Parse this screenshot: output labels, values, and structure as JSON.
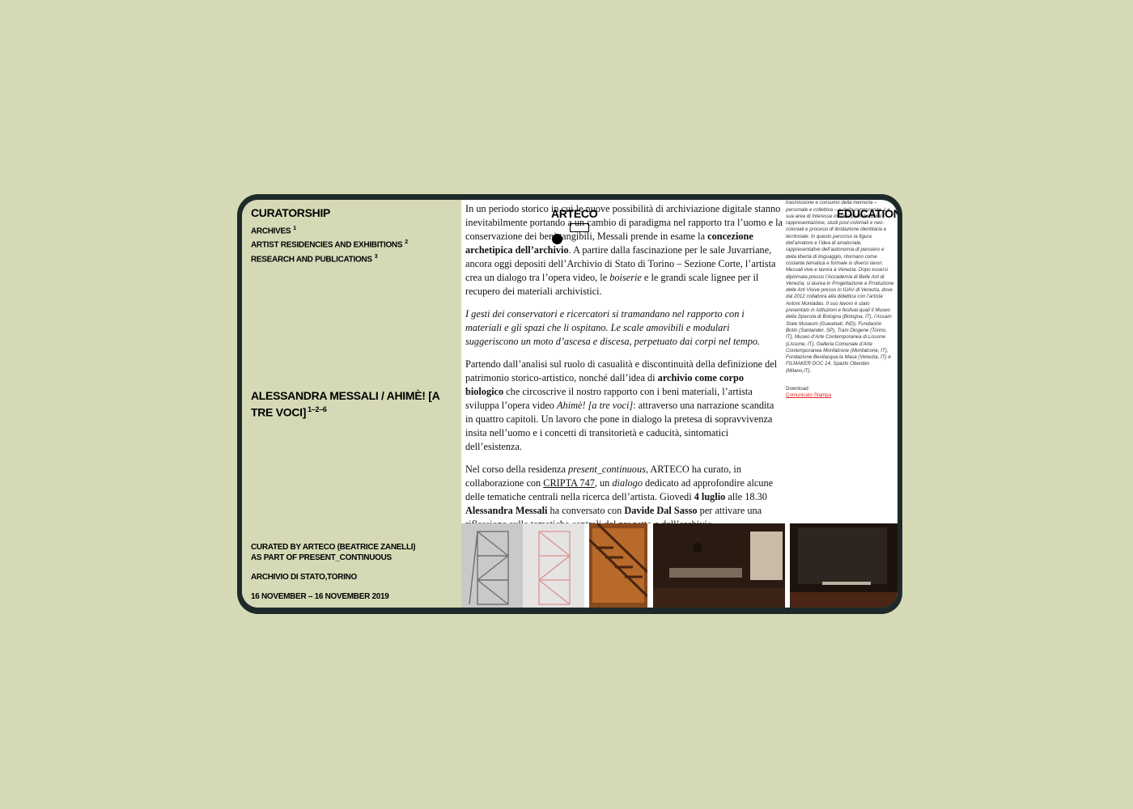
{
  "sidebar": {
    "heading": "CURATORSHIP",
    "nav": [
      {
        "label": "ARCHIVES",
        "sup": "1"
      },
      {
        "label": "ARTIST RESIDENCIES AND EXHIBITIONS",
        "sup": "2"
      },
      {
        "label": "RESEARCH AND PUBLICATIONS",
        "sup": "3"
      }
    ],
    "project_title": "ALESSANDRA MESSALI / AHIMÈ! [A TRE VOCI]",
    "project_sup": "1–2–6",
    "curated_line1": "CURATED BY ARTECO (BEATRICE ZANELLI)",
    "curated_line2": "AS PART OF PRESENT_CONTINUOUS",
    "venue": "ARCHIVIO DI STATO,TORINO",
    "dates": "16 NOVEMBER – 16 NOVEMBER 2019"
  },
  "header": {
    "brand": "ARTECO",
    "education": "EDUCATION"
  },
  "article": {
    "p1_a": "In un periodo storico in cui le nuove possibilità di archiviazione digitale stanno inevitabilmente portando a un cambio di paradigma nel rapporto tra l’uomo e la conservazione dei beni tangibili, Messali prende in esame la ",
    "p1_b": "concezione archetipica dell’archivio",
    "p1_c": ". A partire dalla fascinazione per le sale Juvarriane, ancora oggi depositi dell’Archivio di Stato di Torino – Sezione Corte, l’artista crea un dialogo tra l’opera video, le ",
    "p1_d": "boiserie",
    "p1_e": " e le grandi scale lignee per il recupero dei materiali archivistici.",
    "p2": "I gesti dei conservatori e ricercatori si tramandano nel rapporto con i materiali e gli spazi che li ospitano. Le scale amovibili e modulari suggeriscono un moto d’ascesa e discesa, perpetuato dai corpi nel tempo.",
    "p3_a": "Partendo dall’analisi sul ruolo di casualità e discontinuità della definizione del patrimonio storico-artistico, nonché dall’idea di ",
    "p3_b": "archivio come corpo biologico",
    "p3_c": " che circoscrive il nostro rapporto con i beni materiali, l’artista sviluppa l’opera video ",
    "p3_d": "Ahimè! [a tre voci]",
    "p3_e": ": attraverso una narrazione scandita in quattro capitoli. Un lavoro che pone in dialogo la pretesa di sopravvivenza insita nell’uomo e i concetti di transitorietà e caducità, sintomatici dell’esistenza.",
    "p4_a": "Nel corso della residenza ",
    "p4_b": "present_continuous",
    "p4_c": ", ARTECO ha curato, in collaborazione con ",
    "p4_link": "CRIPTA 747",
    "p4_d": ", un ",
    "p4_e": "dialogo",
    "p4_f": " dedicato ad approfondire alcune delle tematiche centrali nella ricerca dell’artista. Giovedì ",
    "p4_g": "4 luglio",
    "p4_h": " alle 18.30 ",
    "p4_i": "Alessandra Messali",
    "p4_j": " ha conversato con ",
    "p4_k": "Davide Dal Sasso",
    "p4_l": " per attivare una riflessione sulle tematiche centrali del progetto e dell’archivio."
  },
  "bio": {
    "text": "indagine sul processo di definizione, trasmissione e consumo della memoria – personale e collettiva – e della conoscenza. La sua area di interesse include politiche della rappresentazione, studi post-coloniali e neo-coloniali e processi di ibridazione identitaria e territoriale. In questo percorso la figura dell’amatore e l’idea di amatoriale, rappresentative dell’autonomia di pensiero e della libertà di linguaggio, ritornano come costante tematica e formale in diversi lavori. Messali vive e lavora a Venezia. Dopo essersi diplomata presso l’Accademia di Belle Arti di Venezia, si laurea in Progettazione e Produzione delle Arti Visive presso lo IUAV di Venezia, dove dal 2012 collabora alla didattica con l’artista Antoni Muntadas. Il suo lavoro è stato presentato in istituzioni e festival quali Il Museo della Specola di Bologna (Bologna, IT), l’Assam State Museum (Guwahati, IND), Fundación Botín (Santander, SP), Tram Diogene (Torino, IT), Museo d’Arte Contemporanea di Lissone (Lissone, IT), Galleria Comunale d’Arte Contemporanea Monfalcone (Monfalcone, IT), Fondazione Bevilacqua la Masa (Venezia, IT) e FILMAKER DOC 14, Spazio Oberdan (Milano,IT).",
    "download_label": "Download:",
    "download_link": "Comunicato Stampa"
  },
  "gallery": [
    {
      "alt": "scaffold-drawing-grey"
    },
    {
      "alt": "scaffold-drawing-pink"
    },
    {
      "alt": "wooden-staircase"
    },
    {
      "alt": "archive-room-dark"
    },
    {
      "alt": "archive-room-screen"
    }
  ]
}
